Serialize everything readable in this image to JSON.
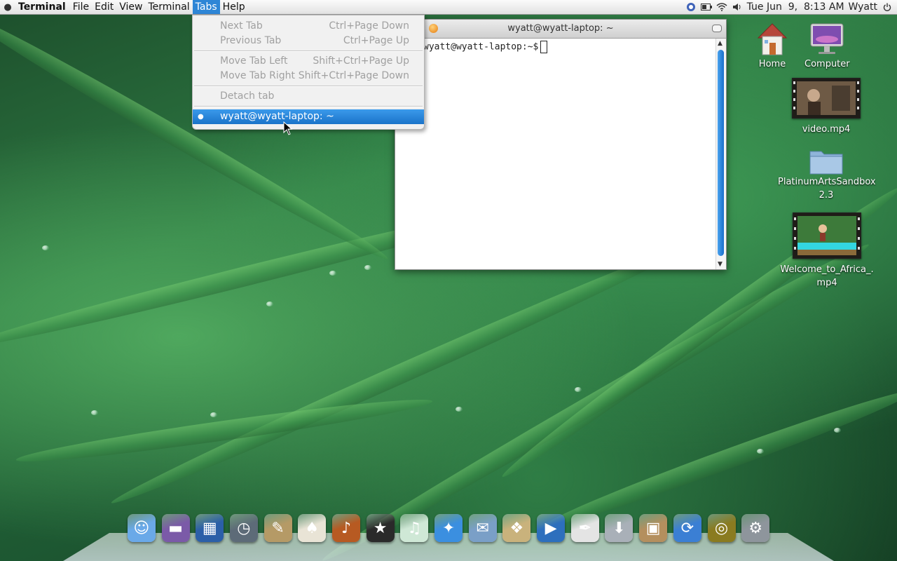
{
  "menubar": {
    "app_name": "Terminal",
    "menus": [
      "File",
      "Edit",
      "View",
      "Terminal",
      "Tabs",
      "Help"
    ],
    "active_menu": "Tabs",
    "clock": "Tue Jun  9,  8:13 AM",
    "user": "Wyatt",
    "tray_icons": [
      "network-manager-icon",
      "battery-icon",
      "wifi-icon",
      "volume-icon"
    ]
  },
  "tabs_menu": {
    "items": [
      {
        "label": "Next Tab",
        "mnemonic": "N",
        "accelerator": "Ctrl+Page Down",
        "enabled": false
      },
      {
        "label": "Previous Tab",
        "mnemonic": "P",
        "accelerator": "Ctrl+Page Up",
        "enabled": false
      },
      {
        "label": "Move Tab Left",
        "mnemonic": "L",
        "accelerator": "Shift+Ctrl+Page Up",
        "enabled": false
      },
      {
        "label": "Move Tab Right",
        "mnemonic": "R",
        "accelerator": "Shift+Ctrl+Page Down",
        "enabled": false
      },
      {
        "label": "Detach tab",
        "mnemonic": "D",
        "accelerator": "",
        "enabled": false
      },
      {
        "label": "wyatt@wyatt-laptop: ~",
        "accelerator": "",
        "enabled": true,
        "selected": true
      }
    ]
  },
  "terminal": {
    "title": "wyatt@wyatt-laptop: ~",
    "prompt": "wyatt@wyatt-laptop:~$"
  },
  "desktop_icons": [
    {
      "label": "Home",
      "icon": "home-icon"
    },
    {
      "label": "Computer",
      "icon": "computer-icon"
    },
    {
      "label": "video.mp4",
      "icon": "video-thumbnail"
    },
    {
      "label": "PlatinumArtsSandbox 2.3",
      "icon": "folder-icon"
    },
    {
      "label": "Welcome_to_Africa_.mp4",
      "icon": "video-thumbnail"
    }
  ],
  "dock": {
    "items": [
      {
        "name": "finder",
        "icon": "finder-icon",
        "color": "#6aa9e8",
        "glyph": "☺"
      },
      {
        "name": "front-row",
        "icon": "desktop-icon",
        "color": "#7b5aa8",
        "glyph": "▬"
      },
      {
        "name": "dashboard",
        "icon": "dashboard-icon",
        "color": "#2b5fa8",
        "glyph": "▦"
      },
      {
        "name": "time-machine",
        "icon": "time-machine-icon",
        "color": "#5d6b78",
        "glyph": "◷"
      },
      {
        "name": "gimp",
        "icon": "gimp-icon",
        "color": "#b59a66",
        "glyph": "✎"
      },
      {
        "name": "solitaire",
        "icon": "cards-icon",
        "color": "#e9e4d6",
        "glyph": "♠"
      },
      {
        "name": "garageband",
        "icon": "guitar-icon",
        "color": "#b75a22",
        "glyph": "♪"
      },
      {
        "name": "imovie",
        "icon": "star-icon",
        "color": "#2a2a2a",
        "glyph": "★"
      },
      {
        "name": "itunes",
        "icon": "music-disc-icon",
        "color": "#cfe8d6",
        "glyph": "♫"
      },
      {
        "name": "safari",
        "icon": "compass-icon",
        "color": "#3b8fe0",
        "glyph": "✦"
      },
      {
        "name": "mail",
        "icon": "mail-icon",
        "color": "#7a9fc7",
        "glyph": "✉"
      },
      {
        "name": "iphoto",
        "icon": "photos-icon",
        "color": "#c9b27c",
        "glyph": "❖"
      },
      {
        "name": "dvd-player",
        "icon": "clapper-icon",
        "color": "#2d6fbd",
        "glyph": "▶"
      },
      {
        "name": "text-editor",
        "icon": "pen-icon",
        "color": "#e4e4e4",
        "glyph": "✒"
      },
      {
        "name": "downloads",
        "icon": "download-icon",
        "color": "#a9b0b8",
        "glyph": "⬇"
      },
      {
        "name": "package-installer",
        "icon": "package-icon",
        "color": "#b48f5e",
        "glyph": "▣"
      },
      {
        "name": "sync",
        "icon": "sync-icon",
        "color": "#3b7fd4",
        "glyph": "⟳"
      },
      {
        "name": "radar",
        "icon": "radar-icon",
        "color": "#8a7b20",
        "glyph": "◎"
      },
      {
        "name": "system-preferences",
        "icon": "gear-icon",
        "color": "#8e959c",
        "glyph": "⚙"
      }
    ]
  }
}
